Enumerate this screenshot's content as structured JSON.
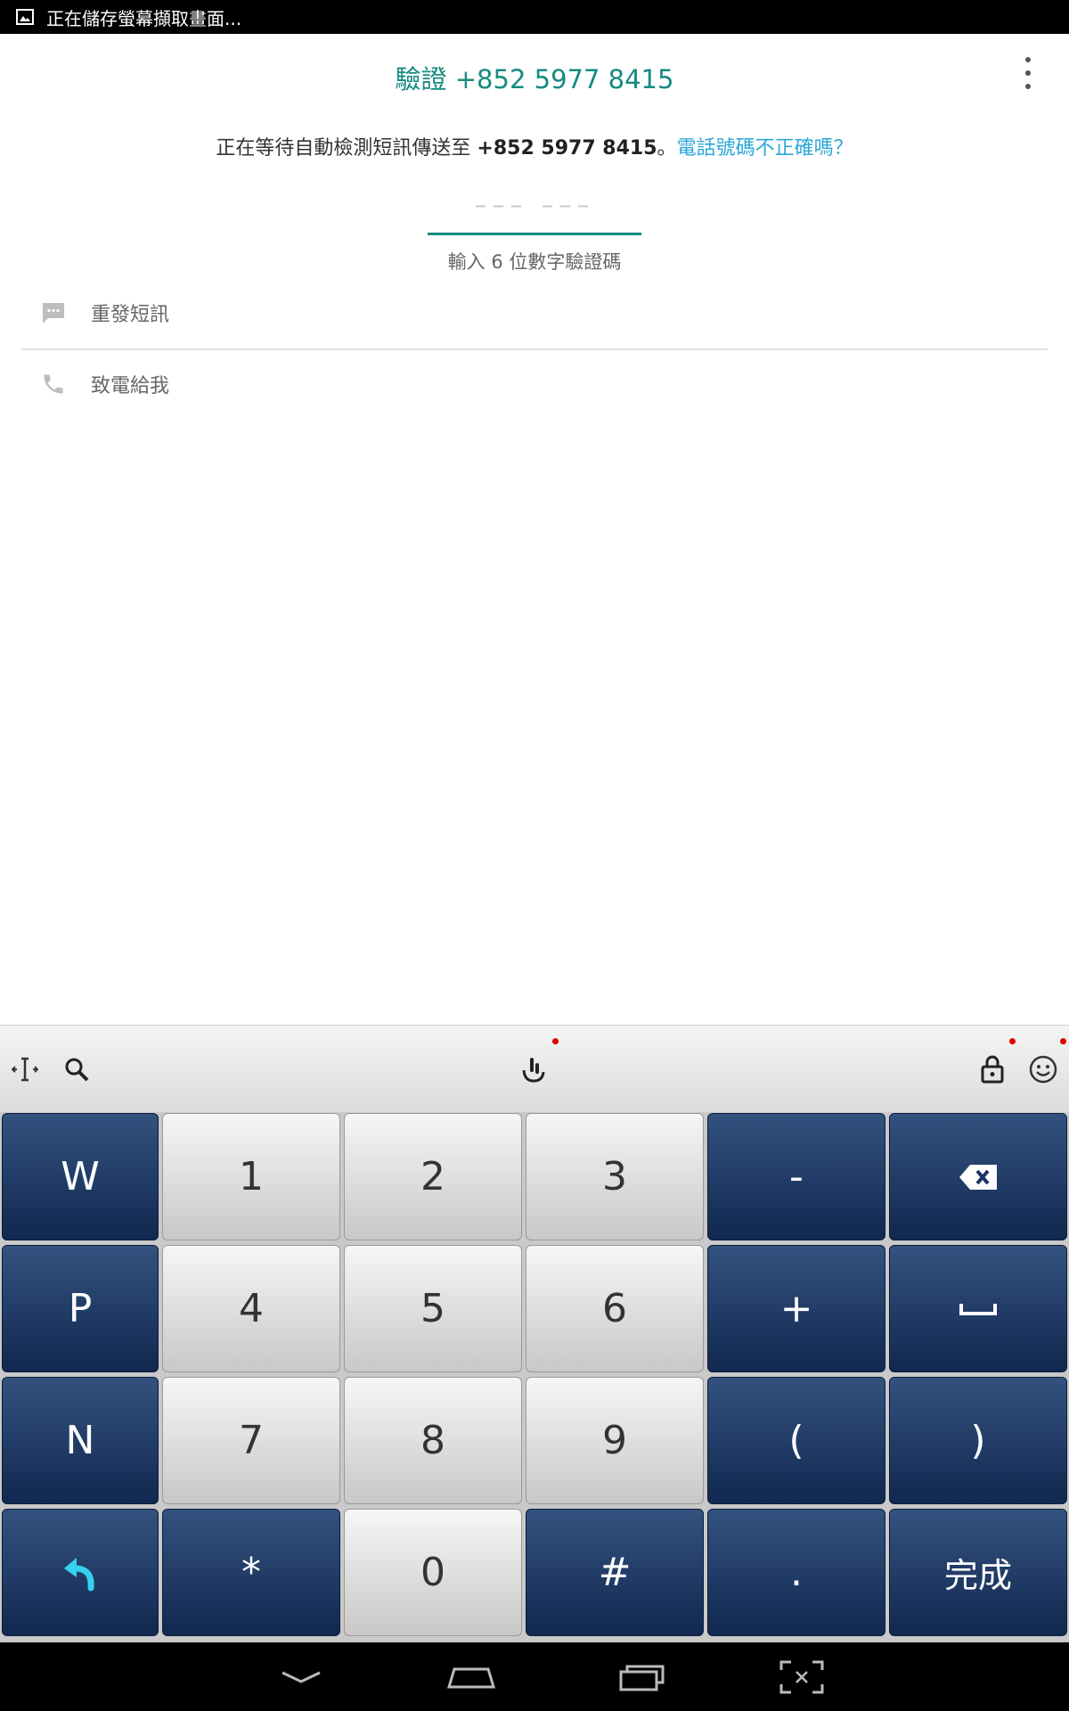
{
  "status_bar": {
    "text": "正在儲存螢幕擷取畫面..."
  },
  "header": {
    "title": "驗證 +852 5977 8415"
  },
  "instruction": {
    "prefix": "正在等待自動檢測短訊傳送至 ",
    "phone": "+852 5977 8415",
    "suffix": "。",
    "wrong_number_link": "電話號碼不正確嗎？"
  },
  "code_input": {
    "placeholder": "––– –––",
    "hint": "輸入 6 位數字驗證碼"
  },
  "options": {
    "resend_sms": "重發短訊",
    "call_me": "致電給我"
  },
  "keyboard": {
    "rows": [
      [
        "W",
        "1",
        "2",
        "3",
        "-",
        "⌫"
      ],
      [
        "P",
        "4",
        "5",
        "6",
        "+",
        "␣"
      ],
      [
        "N",
        "7",
        "8",
        "9",
        "(",
        ")"
      ],
      [
        "↩",
        "*",
        "0",
        "#",
        ".",
        "完成"
      ]
    ]
  },
  "colors": {
    "accent": "#158b7f",
    "link": "#2aa7d8",
    "key_dark": "#1e3a66",
    "key_light": "#e6e6e6"
  }
}
